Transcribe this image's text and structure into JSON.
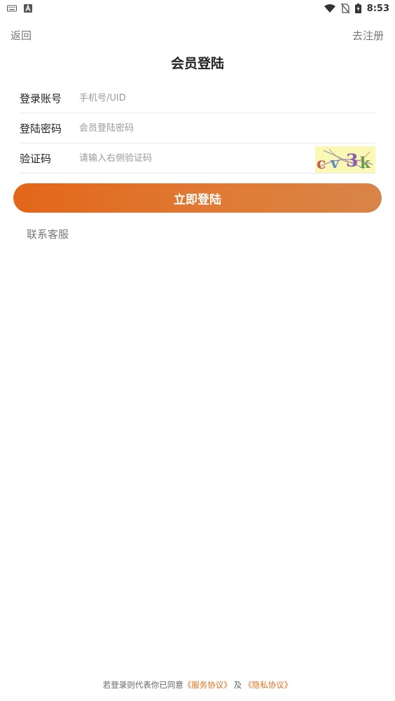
{
  "status_bar": {
    "time": "8:53",
    "left_icons": [
      "keyboard-icon",
      "a-letter-icon"
    ],
    "right_icons": [
      "wifi-icon",
      "no-sim-icon",
      "battery-icon"
    ]
  },
  "header": {
    "back_label": "返回",
    "register_label": "去注册",
    "title": "会员登陆"
  },
  "form": {
    "account": {
      "label": "登录账号",
      "value": "",
      "placeholder": "手机号/UID"
    },
    "password": {
      "label": "登陆密码",
      "value": "",
      "placeholder": "会员登陆密码"
    },
    "captcha": {
      "label": "验证码",
      "value": "",
      "placeholder": "请输入右侧验证码",
      "image_text": "CV3k"
    }
  },
  "login_button_label": "立即登陆",
  "contact_label": "联系客服",
  "agreement": {
    "prefix": "若登录则代表你已同意",
    "service_link": "《服务协议》",
    "conjunction": "及",
    "privacy_link": "《隐私协议》"
  },
  "colors": {
    "accent": "#e2661a",
    "accent_end": "#d88548",
    "link": "#e07020",
    "captcha_bg": "#fbf8b5"
  }
}
